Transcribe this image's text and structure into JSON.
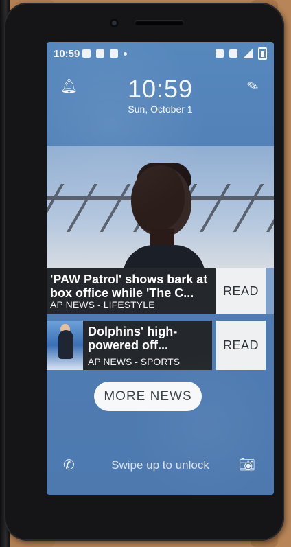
{
  "statusbar": {
    "time": "10:59"
  },
  "lockscreen": {
    "clock": "10:59",
    "date": "Sun, October 1",
    "bell_icon": "bell-icon",
    "edit_icon": "pencil-icon"
  },
  "stories": [
    {
      "headline": "'PAW Patrol' shows bark at box office while 'The C...",
      "source": "AP NEWS - LIFESTYLE",
      "action": "READ"
    },
    {
      "headline": "Dolphins' high-powered off...",
      "source": "AP NEWS - SPORTS",
      "action": "READ"
    }
  ],
  "more_news_label": "MORE NEWS",
  "footer": {
    "swipe_text": "Swipe up to unlock",
    "phone_icon": "phone-icon",
    "camera_icon": "camera-icon"
  },
  "colors": {
    "screen_blue": "#4f7eb5",
    "card_dark": "#24272c",
    "button_light": "#eef0f2"
  }
}
